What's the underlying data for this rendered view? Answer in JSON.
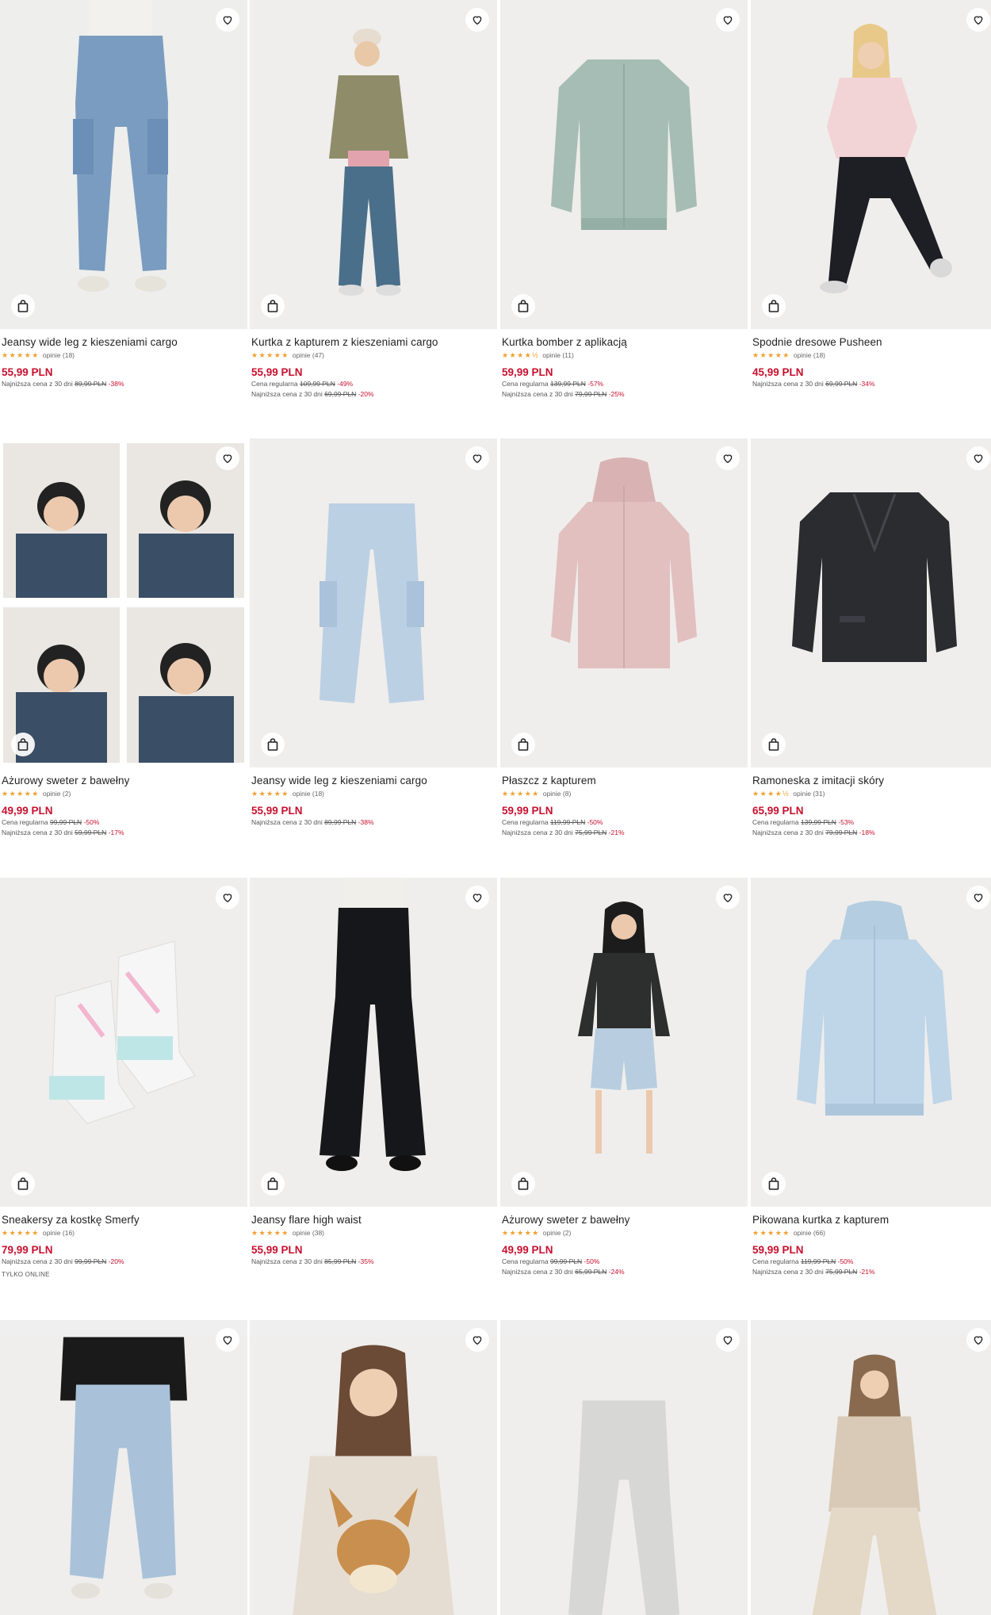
{
  "colors": {
    "price": "#c8102e",
    "star": "#f0a030",
    "image_bg": "#efefef"
  },
  "icons": {
    "favorite": "heart-outline-icon",
    "add_to_bag": "shopping-bag-icon"
  },
  "products": [
    {
      "name": "Jeansy wide leg z kieszeniami cargo",
      "stars": "★★★★★",
      "reviews": "opinie (18)",
      "price": "55,99 PLN",
      "lines": [
        {
          "label": "Najniższa cena z 30 dni",
          "old": "89,99 PLN",
          "disc": "-38%"
        }
      ],
      "tag": ""
    },
    {
      "name": "Kurtka z kapturem z kieszeniami cargo",
      "stars": "★★★★★",
      "reviews": "opinie (47)",
      "price": "55,99 PLN",
      "lines": [
        {
          "label": "Cena regularna",
          "old": "109,99 PLN",
          "disc": "-49%"
        },
        {
          "label": "Najniższa cena z 30 dni",
          "old": "69,99 PLN",
          "disc": "-20%"
        }
      ],
      "tag": ""
    },
    {
      "name": "Kurtka bomber z aplikacją",
      "stars": "★★★★½",
      "reviews": "opinie (11)",
      "price": "59,99 PLN",
      "lines": [
        {
          "label": "Cena regularna",
          "old": "139,99 PLN",
          "disc": "-57%"
        },
        {
          "label": "Najniższa cena z 30 dni",
          "old": "79,99 PLN",
          "disc": "-25%"
        }
      ],
      "tag": ""
    },
    {
      "name": "Spodnie dresowe Pusheen",
      "stars": "★★★★★",
      "reviews": "opinie (18)",
      "price": "45,99 PLN",
      "lines": [
        {
          "label": "Najniższa cena z 30 dni",
          "old": "69,99 PLN",
          "disc": "-34%"
        }
      ],
      "tag": ""
    },
    {
      "name": "Ażurowy sweter z bawełny",
      "stars": "★★★★★",
      "reviews": "opinie (2)",
      "price": "49,99 PLN",
      "lines": [
        {
          "label": "Cena regularna",
          "old": "99,99 PLN",
          "disc": "-50%"
        },
        {
          "label": "Najniższa cena z 30 dni",
          "old": "59,99 PLN",
          "disc": "-17%"
        }
      ],
      "tag": ""
    },
    {
      "name": "Jeansy wide leg z kieszeniami cargo",
      "stars": "★★★★★",
      "reviews": "opinie (18)",
      "price": "55,99 PLN",
      "lines": [
        {
          "label": "Najniższa cena z 30 dni",
          "old": "89,99 PLN",
          "disc": "-38%"
        }
      ],
      "tag": ""
    },
    {
      "name": "Płaszcz z kapturem",
      "stars": "★★★★★",
      "reviews": "opinie (8)",
      "price": "59,99 PLN",
      "lines": [
        {
          "label": "Cena regularna",
          "old": "119,99 PLN",
          "disc": "-50%"
        },
        {
          "label": "Najniższa cena z 30 dni",
          "old": "75,99 PLN",
          "disc": "-21%"
        }
      ],
      "tag": ""
    },
    {
      "name": "Ramoneska z imitacji skóry",
      "stars": "★★★★½",
      "reviews": "opinie (31)",
      "price": "65,99 PLN",
      "lines": [
        {
          "label": "Cena regularna",
          "old": "139,99 PLN",
          "disc": "-53%"
        },
        {
          "label": "Najniższa cena z 30 dni",
          "old": "79,99 PLN",
          "disc": "-18%"
        }
      ],
      "tag": ""
    },
    {
      "name": "Sneakersy za kostkę Smerfy",
      "stars": "★★★★★",
      "reviews": "opinie (16)",
      "price": "79,99 PLN",
      "lines": [
        {
          "label": "Najniższa cena z 30 dni",
          "old": "99,99 PLN",
          "disc": "-20%"
        }
      ],
      "tag": "TYLKO ONLINE"
    },
    {
      "name": "Jeansy flare high waist",
      "stars": "★★★★★",
      "reviews": "opinie (38)",
      "price": "55,99 PLN",
      "lines": [
        {
          "label": "Najniższa cena z 30 dni",
          "old": "85,99 PLN",
          "disc": "-35%"
        }
      ],
      "tag": ""
    },
    {
      "name": "Ażurowy sweter z bawełny",
      "stars": "★★★★★",
      "reviews": "opinie (2)",
      "price": "49,99 PLN",
      "lines": [
        {
          "label": "Cena regularna",
          "old": "99,99 PLN",
          "disc": "-50%"
        },
        {
          "label": "Najniższa cena z 30 dni",
          "old": "65,99 PLN",
          "disc": "-24%"
        }
      ],
      "tag": ""
    },
    {
      "name": "Pikowana kurtka z kapturem",
      "stars": "★★★★★",
      "reviews": "opinie (66)",
      "price": "59,99 PLN",
      "lines": [
        {
          "label": "Cena regularna",
          "old": "119,99 PLN",
          "disc": "-50%"
        },
        {
          "label": "Najniższa cena z 30 dni",
          "old": "75,99 PLN",
          "disc": "-21%"
        }
      ],
      "tag": ""
    }
  ]
}
